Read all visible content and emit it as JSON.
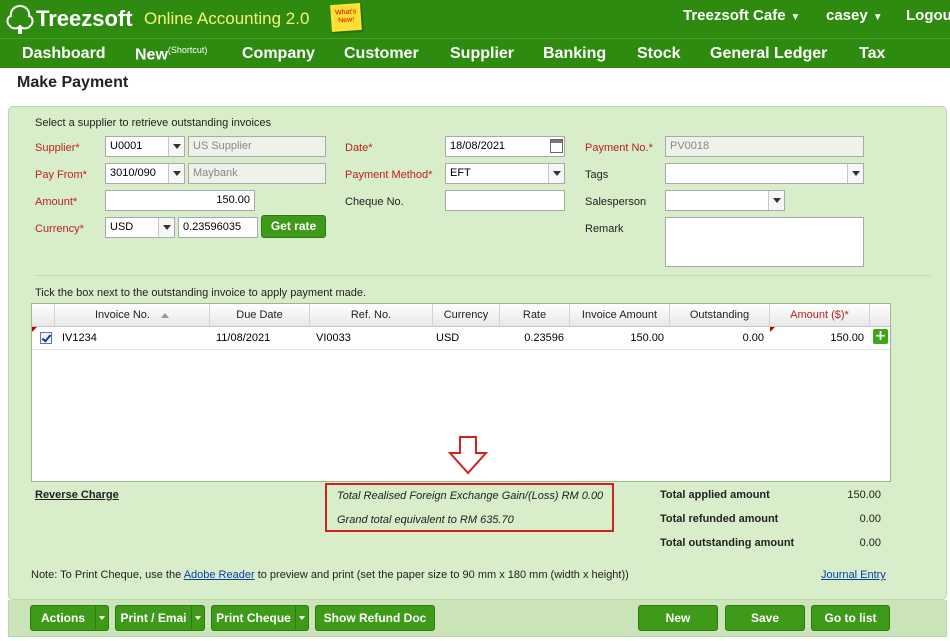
{
  "header": {
    "brand": "Treezsoft",
    "product": "Online Accounting 2.0",
    "whats_new": "What's New!",
    "company_menu": "Treezsoft Cafe",
    "user_menu": "casey",
    "logout": "Logou"
  },
  "nav": {
    "dashboard": "Dashboard",
    "new": "New",
    "new_sup": "(Shortcut)",
    "company": "Company",
    "customer": "Customer",
    "supplier": "Supplier",
    "banking": "Banking",
    "stock": "Stock",
    "general_ledger": "General Ledger",
    "tax": "Tax"
  },
  "page": {
    "title": "Make Payment"
  },
  "form": {
    "intro": "Select a supplier to retrieve outstanding invoices",
    "supplier_label": "Supplier*",
    "supplier_code": "U0001",
    "supplier_name": "US Supplier",
    "pay_from_label": "Pay From*",
    "pay_from_code": "3010/090",
    "pay_from_name": "Maybank",
    "amount_label": "Amount*",
    "amount_value": "150.00",
    "currency_label": "Currency*",
    "currency_value": "USD",
    "rate_value": "0.23596035",
    "get_rate_button": "Get rate",
    "date_label": "Date*",
    "date_value": "18/08/2021",
    "payment_method_label": "Payment Method*",
    "payment_method_value": "EFT",
    "cheque_no_label": "Cheque No.",
    "cheque_no_value": "",
    "payment_no_label": "Payment No.*",
    "payment_no_value": "PV0018",
    "tags_label": "Tags",
    "tags_value": "",
    "salesperson_label": "Salesperson",
    "salesperson_value": "",
    "remark_label": "Remark",
    "remark_value": ""
  },
  "invoices": {
    "instruction": "Tick the box next to the outstanding invoice to apply payment made.",
    "columns": {
      "invoice_no": "Invoice No.",
      "due_date": "Due Date",
      "ref_no": "Ref. No.",
      "currency": "Currency",
      "rate": "Rate",
      "invoice_amount": "Invoice Amount",
      "outstanding": "Outstanding",
      "amount": "Amount ($)*"
    },
    "rows": [
      {
        "checked": true,
        "invoice_no": "IV1234",
        "due_date": "11/08/2021",
        "ref_no": "VI0033",
        "currency": "USD",
        "rate": "0.23596",
        "invoice_amount": "150.00",
        "outstanding": "0.00",
        "amount": "150.00"
      }
    ]
  },
  "totals": {
    "reverse_charge": "Reverse Charge",
    "fx_gain_loss": "Total Realised Foreign Exchange Gain/(Loss) RM 0.00",
    "grand_total_equivalent": "Grand total equivalent to RM 635.70",
    "applied_label": "Total applied amount",
    "applied_value": "150.00",
    "refunded_label": "Total refunded amount",
    "refunded_value": "0.00",
    "outstanding_label": "Total outstanding amount",
    "outstanding_value": "0.00"
  },
  "note": {
    "prefix": "Note: To Print Cheque, use the",
    "link": "Adobe Reader",
    "suffix": "to preview and print (set the paper size to 90 mm x 180 mm (width x height))",
    "journal_entry": "Journal Entry"
  },
  "footer": {
    "actions": "Actions",
    "print_email": "Print / Emai",
    "print_cheque": "Print Cheque",
    "show_refund_doc": "Show Refund Doc",
    "new": "New",
    "save": "Save",
    "go_to_list": "Go to list"
  },
  "colors": {
    "header_green": "#2e8b10",
    "panel_green": "#d8edc9",
    "button_green": "#3e9a18",
    "required_red": "#b22222",
    "highlight_red": "#d02020"
  },
  "icons": {
    "logo": "tree-icon",
    "annotation": "down-arrow-outline-icon",
    "calendar": "calendar-icon",
    "add_row": "plus-icon"
  }
}
